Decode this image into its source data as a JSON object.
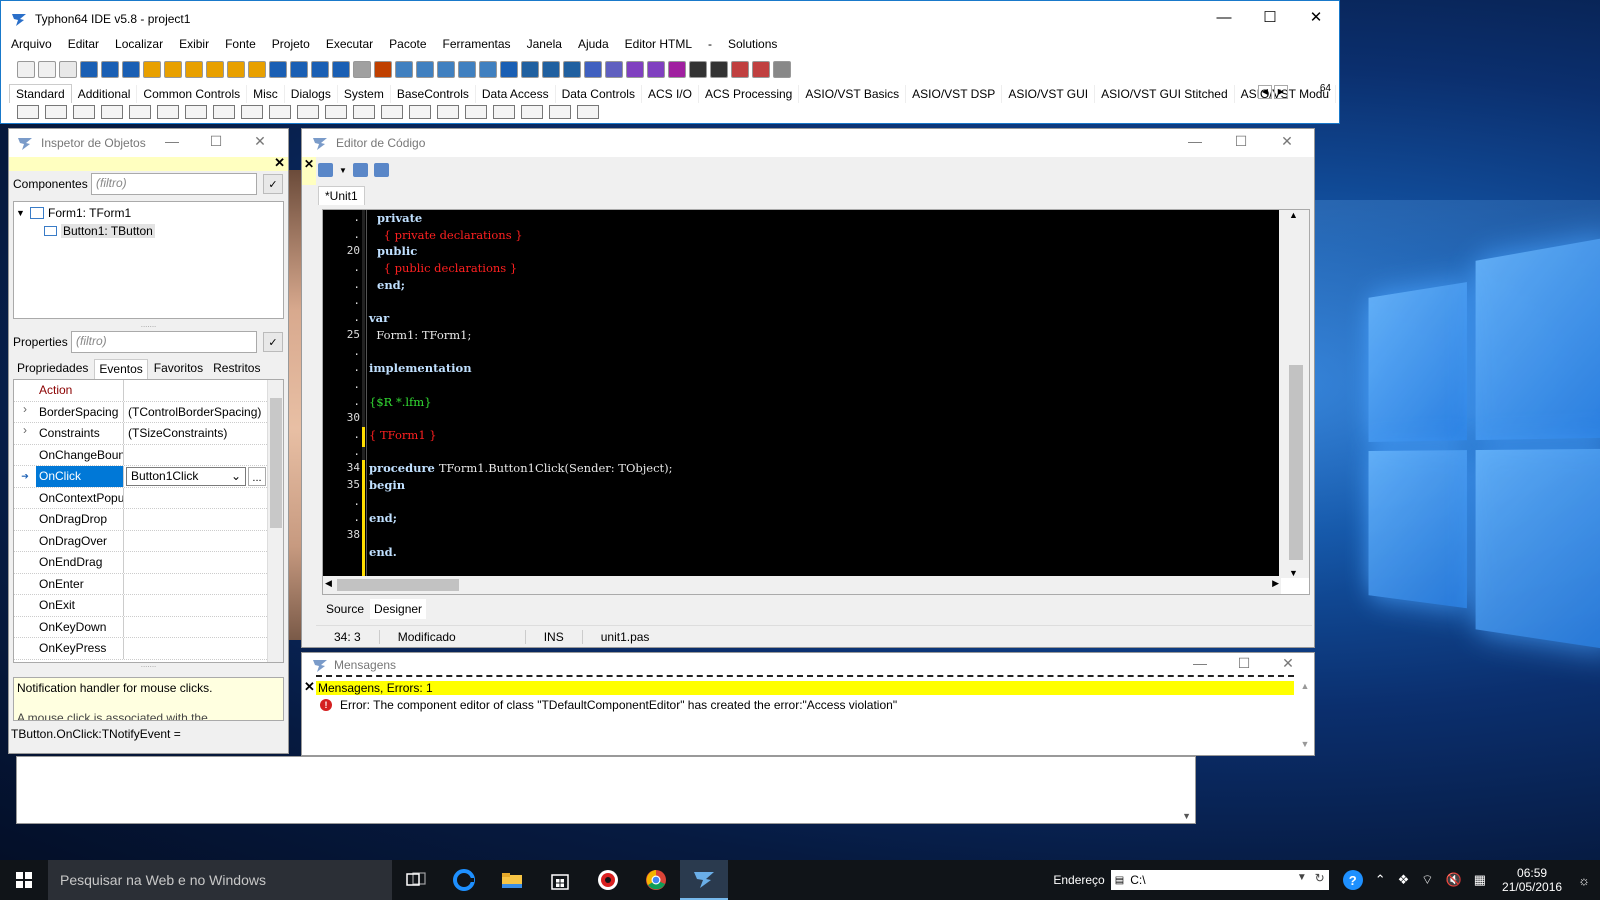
{
  "main_window": {
    "title": "Typhon64 IDE v5.8 - project1",
    "menu": [
      "Arquivo",
      "Editar",
      "Localizar",
      "Exibir",
      "Fonte",
      "Projeto",
      "Executar",
      "Pacote",
      "Ferramentas",
      "Janela",
      "Ajuda",
      "Editor HTML",
      "-",
      "Solutions"
    ],
    "palette_tabs": [
      "Standard",
      "Additional",
      "Common Controls",
      "Misc",
      "Dialogs",
      "System",
      "BaseControls",
      "Data Access",
      "Data Controls",
      "ACS I/O",
      "ACS Processing",
      "ASIO/VST Basics",
      "ASIO/VST DSP",
      "ASIO/VST GUI",
      "ASIO/VST GUI Stitched",
      "ASIO/VST Modu"
    ],
    "bitness": "64"
  },
  "object_inspector": {
    "title": "Inspetor de Objetos",
    "components_label": "Componentes",
    "components_filter_placeholder": "(filtro)",
    "tree": [
      {
        "label": "Form1: TForm1"
      },
      {
        "label": "Button1: TButton"
      }
    ],
    "properties_label": "Properties",
    "properties_filter_placeholder": "(filtro)",
    "tabs": [
      "Propriedades",
      "Eventos",
      "Favoritos",
      "Restritos"
    ],
    "active_tab": "Eventos",
    "rows": [
      {
        "name": "Action",
        "value": ""
      },
      {
        "name": "BorderSpacing",
        "value": "(TControlBorderSpacing)"
      },
      {
        "name": "Constraints",
        "value": "(TSizeConstraints)"
      },
      {
        "name": "OnChangeBoun",
        "value": ""
      },
      {
        "name": "OnClick",
        "value": "Button1Click"
      },
      {
        "name": "OnContextPopu",
        "value": ""
      },
      {
        "name": "OnDragDrop",
        "value": ""
      },
      {
        "name": "OnDragOver",
        "value": ""
      },
      {
        "name": "OnEndDrag",
        "value": ""
      },
      {
        "name": "OnEnter",
        "value": ""
      },
      {
        "name": "OnExit",
        "value": ""
      },
      {
        "name": "OnKeyDown",
        "value": ""
      },
      {
        "name": "OnKeyPress",
        "value": ""
      }
    ],
    "help_text": "Notification handler for mouse clicks.",
    "help_text_2": "A mouse click is associated with the",
    "status": "TButton.OnClick:TNotifyEvent ="
  },
  "code_editor": {
    "title": "Editor de Código",
    "tab": "*Unit1",
    "gutter": [
      ".",
      ".",
      "20",
      ".",
      ".",
      ".",
      ".",
      "25",
      ".",
      ".",
      ".",
      ".",
      "30",
      ".",
      ".",
      "34",
      "35",
      ".",
      ".",
      "38"
    ],
    "lines": [
      [
        {
          "c": "kw",
          "t": "  private"
        }
      ],
      [
        {
          "c": "cm",
          "t": "    { private declarations }"
        }
      ],
      [
        {
          "c": "kw",
          "t": "  public"
        }
      ],
      [
        {
          "c": "cm",
          "t": "    { public declarations }"
        }
      ],
      [
        {
          "c": "kw",
          "t": "  end;"
        }
      ],
      [
        {
          "c": "id",
          "t": ""
        }
      ],
      [
        {
          "c": "kw",
          "t": "var"
        }
      ],
      [
        {
          "c": "id",
          "t": "  Form1: TForm1;"
        }
      ],
      [
        {
          "c": "id",
          "t": ""
        }
      ],
      [
        {
          "c": "kw",
          "t": "implementation"
        }
      ],
      [
        {
          "c": "id",
          "t": ""
        }
      ],
      [
        {
          "c": "dir",
          "t": "{$R *.lfm}"
        }
      ],
      [
        {
          "c": "id",
          "t": ""
        }
      ],
      [
        {
          "c": "cm",
          "t": "{ TForm1 }"
        }
      ],
      [
        {
          "c": "id",
          "t": ""
        }
      ],
      [
        {
          "c": "kw",
          "t": "procedure "
        },
        {
          "c": "id",
          "t": "TForm1.Button1Click(Sender: TObject);"
        }
      ],
      [
        {
          "c": "kw",
          "t": "begin"
        }
      ],
      [
        {
          "c": "id",
          "t": ""
        }
      ],
      [
        {
          "c": "kw",
          "t": "end;"
        }
      ],
      [
        {
          "c": "id",
          "t": ""
        }
      ],
      [
        {
          "c": "kw",
          "t": "end."
        }
      ],
      [
        {
          "c": "id",
          "t": ""
        }
      ]
    ],
    "bottom_tabs": [
      "Source",
      "Designer"
    ],
    "active_bottom_tab": "Designer",
    "status": {
      "position": "34:  3",
      "state": "Modificado",
      "mode": "INS",
      "file": "unit1.pas"
    }
  },
  "messages": {
    "title": "Mensagens",
    "header": "Mensagens, Errors: 1",
    "error": "Error: The component editor of class \"TDefaultComponentEditor\" has created the error:\"Access violation\""
  },
  "taskbar": {
    "search_placeholder": "Pesquisar na Web e no Windows",
    "address_label": "Endereço",
    "address_value": "C:\\",
    "time": "06:59",
    "date": "21/05/2016"
  },
  "colors": {
    "accent": "#0078d7",
    "editor_bg": "#000000",
    "keyword": "#c0e0ff",
    "comment": "#ff2020",
    "directive": "#33dd33",
    "error_bar": "#ffff00"
  }
}
